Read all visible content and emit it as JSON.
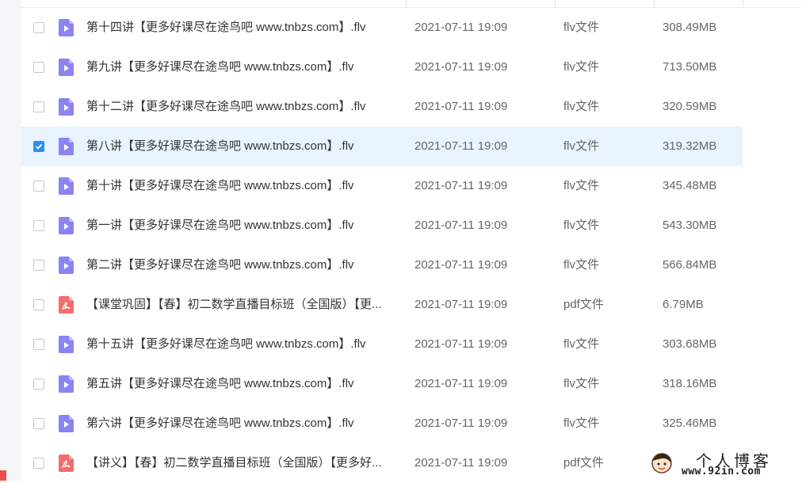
{
  "file_list": {
    "rows": [
      {
        "name": "第十四讲【更多好课尽在途鸟吧 www.tnbzs.com】.flv",
        "date": "2021-07-11 19:09",
        "type": "flv文件",
        "size": "308.49MB",
        "icon": "video-file-icon",
        "checked": false
      },
      {
        "name": "第九讲【更多好课尽在途鸟吧 www.tnbzs.com】.flv",
        "date": "2021-07-11 19:09",
        "type": "flv文件",
        "size": "713.50MB",
        "icon": "video-file-icon",
        "checked": false
      },
      {
        "name": "第十二讲【更多好课尽在途鸟吧 www.tnbzs.com】.flv",
        "date": "2021-07-11 19:09",
        "type": "flv文件",
        "size": "320.59MB",
        "icon": "video-file-icon",
        "checked": false
      },
      {
        "name": "第八讲【更多好课尽在途鸟吧 www.tnbzs.com】.flv",
        "date": "2021-07-11 19:09",
        "type": "flv文件",
        "size": "319.32MB",
        "icon": "video-file-icon",
        "checked": true
      },
      {
        "name": "第十讲【更多好课尽在途鸟吧 www.tnbzs.com】.flv",
        "date": "2021-07-11 19:09",
        "type": "flv文件",
        "size": "345.48MB",
        "icon": "video-file-icon",
        "checked": false
      },
      {
        "name": "第一讲【更多好课尽在途鸟吧 www.tnbzs.com】.flv",
        "date": "2021-07-11 19:09",
        "type": "flv文件",
        "size": "543.30MB",
        "icon": "video-file-icon",
        "checked": false
      },
      {
        "name": "第二讲【更多好课尽在途鸟吧 www.tnbzs.com】.flv",
        "date": "2021-07-11 19:09",
        "type": "flv文件",
        "size": "566.84MB",
        "icon": "video-file-icon",
        "checked": false
      },
      {
        "name": "【课堂巩固】【春】初二数学直播目标班（全国版）【更...",
        "date": "2021-07-11 19:09",
        "type": "pdf文件",
        "size": "6.79MB",
        "icon": "pdf-file-icon",
        "checked": false
      },
      {
        "name": "第十五讲【更多好课尽在途鸟吧 www.tnbzs.com】.flv",
        "date": "2021-07-11 19:09",
        "type": "flv文件",
        "size": "303.68MB",
        "icon": "video-file-icon",
        "checked": false
      },
      {
        "name": "第五讲【更多好课尽在途鸟吧 www.tnbzs.com】.flv",
        "date": "2021-07-11 19:09",
        "type": "flv文件",
        "size": "318.16MB",
        "icon": "video-file-icon",
        "checked": false
      },
      {
        "name": "第六讲【更多好课尽在途鸟吧 www.tnbzs.com】.flv",
        "date": "2021-07-11 19:09",
        "type": "flv文件",
        "size": "325.46MB",
        "icon": "video-file-icon",
        "checked": false
      },
      {
        "name": "【讲义】【春】初二数学直播目标班（全国版）【更多好...",
        "date": "2021-07-11 19:09",
        "type": "pdf文件",
        "size": "",
        "icon": "pdf-file-icon",
        "checked": false
      }
    ]
  },
  "watermark": {
    "title": "个人博客",
    "url": "www.92in.com"
  },
  "colors": {
    "video_icon": "#8b83f2",
    "pdf_icon": "#f26d6d",
    "selected_row": "#e8f4ff",
    "checkbox_checked": "#2f8cf0"
  }
}
